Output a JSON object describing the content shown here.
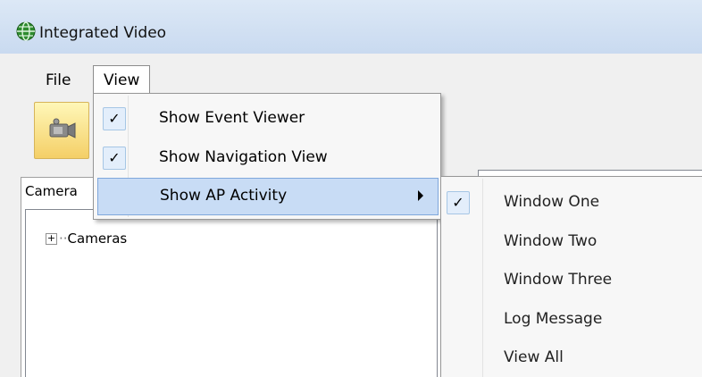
{
  "window": {
    "title": "Integrated Video"
  },
  "menubar": {
    "file": "File",
    "view": "View"
  },
  "view_menu": {
    "items": [
      {
        "label": "Show Event Viewer",
        "checked": true,
        "check_glyph": "✓"
      },
      {
        "label": "Show Navigation View",
        "checked": true,
        "check_glyph": "✓"
      },
      {
        "label": "Show AP Activity",
        "has_submenu": true,
        "highlighted": true
      }
    ]
  },
  "ap_submenu": {
    "items": [
      {
        "label": "Window One",
        "checked": true,
        "check_glyph": "✓"
      },
      {
        "label": "Window Two",
        "checked": false
      },
      {
        "label": "Window Three",
        "checked": false
      },
      {
        "label": "Log Message",
        "checked": false
      },
      {
        "label": "View All",
        "checked": false
      }
    ]
  },
  "left_panel": {
    "tab_label": "Camera",
    "tree_root": "Cameras",
    "expand_glyph": "+"
  },
  "toolbar": {
    "camera_button_icon": "video-camera-icon"
  },
  "colors": {
    "highlight": "#c8dcf5",
    "highlight_border": "#7fa7dc",
    "titlebar": "#dce8f6"
  }
}
